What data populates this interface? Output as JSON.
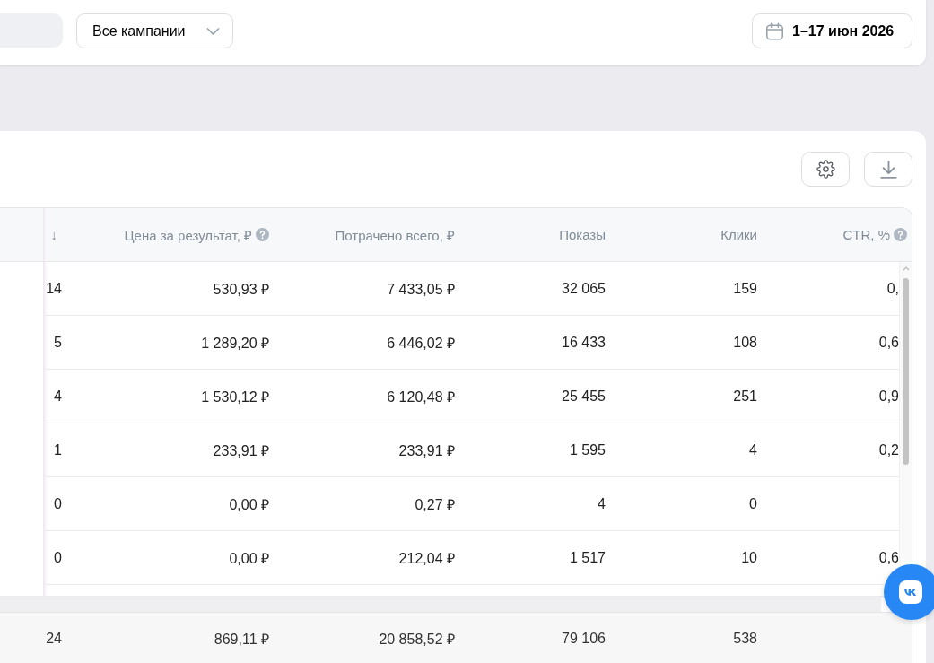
{
  "filter_bar": {
    "campaign_filter": {
      "value": "Все кампании"
    },
    "date_range": {
      "label": "1–17 июн 2026"
    }
  },
  "report": {
    "actions": [
      {
        "kind": "settings"
      },
      {
        "kind": "download"
      }
    ],
    "table": {
      "columns": [
        {
          "sort_indicator": "↓",
          "help": false
        },
        {
          "label": "Цена за результат, ₽",
          "help": true
        },
        {
          "label": "Потрачено всего, ₽",
          "help": false
        },
        {
          "label": "Показы",
          "help": false
        },
        {
          "label": "Клики",
          "help": false
        },
        {
          "label": "CTR, %",
          "help": true
        }
      ],
      "rows": [
        {
          "cells": [
            "14",
            "530,93 ₽",
            "7 433,05 ₽",
            "32 065",
            "159",
            "0,"
          ]
        },
        {
          "cells": [
            "5",
            "1 289,20 ₽",
            "6 446,02 ₽",
            "16 433",
            "108",
            "0,6"
          ]
        },
        {
          "cells": [
            "4",
            "1 530,12 ₽",
            "6 120,48 ₽",
            "25 455",
            "251",
            "0,9"
          ]
        },
        {
          "cells": [
            "1",
            "233,91 ₽",
            "233,91 ₽",
            "1 595",
            "4",
            "0,2"
          ]
        },
        {
          "cells": [
            "0",
            "0,00 ₽",
            "0,27 ₽",
            "4",
            "0"
          ]
        },
        {
          "cells": [
            "0",
            "0,00 ₽",
            "212,04 ₽",
            "1 517",
            "10",
            "0,6"
          ]
        }
      ],
      "totals": [
        "24",
        "869,11 ₽",
        "20 858,52 ₽",
        "79 106",
        "538"
      ]
    }
  }
}
